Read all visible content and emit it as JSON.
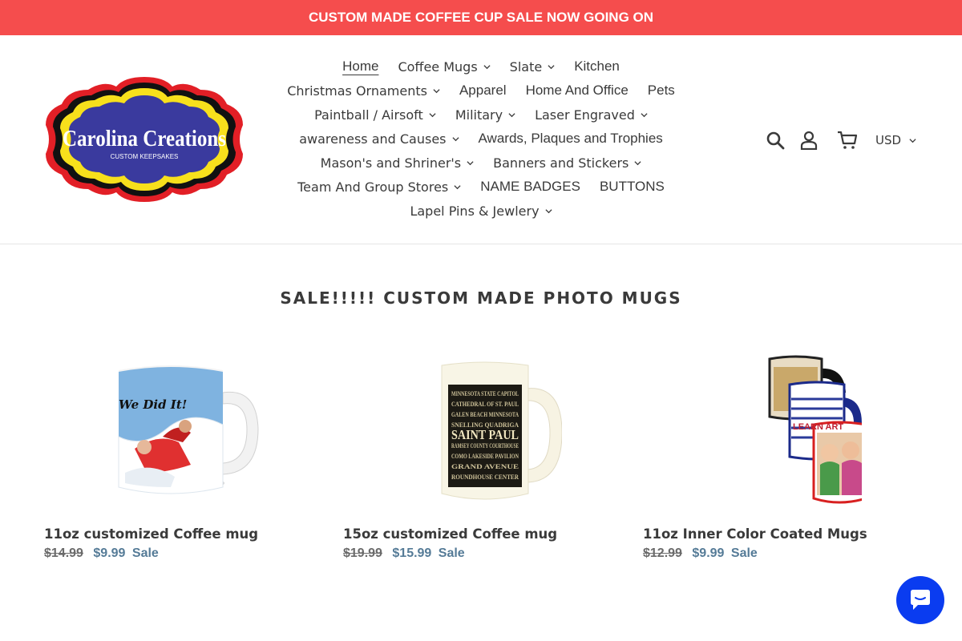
{
  "announcement": "CUSTOM MADE COFFEE CUP SALE NOW GOING ON",
  "logo": {
    "name": "Carolina Creations",
    "tagline": "CUSTOM KEEPSAKES"
  },
  "nav": {
    "rows": [
      [
        {
          "label": "Home",
          "dropdown": false,
          "active": true
        },
        {
          "label": "Coffee Mugs",
          "dropdown": true
        },
        {
          "label": "Slate",
          "dropdown": true
        },
        {
          "label": "Kitchen",
          "dropdown": false
        }
      ],
      [
        {
          "label": "Christmas Ornaments",
          "dropdown": true
        },
        {
          "label": "Apparel",
          "dropdown": false
        },
        {
          "label": "Home And Office",
          "dropdown": false
        },
        {
          "label": "Pets",
          "dropdown": false
        }
      ],
      [
        {
          "label": "Paintball / Airsoft",
          "dropdown": true
        },
        {
          "label": "Military",
          "dropdown": true
        },
        {
          "label": "Laser Engraved",
          "dropdown": true
        }
      ],
      [
        {
          "label": "awareness and Causes",
          "dropdown": true
        },
        {
          "label": "Awards, Plaques and Trophies",
          "dropdown": false
        }
      ],
      [
        {
          "label": "Mason's and Shriner's",
          "dropdown": true
        },
        {
          "label": "Banners and Stickers",
          "dropdown": true
        }
      ],
      [
        {
          "label": "Team And Group Stores",
          "dropdown": true
        },
        {
          "label": "NAME BADGES",
          "dropdown": false
        },
        {
          "label": "BUTTONS",
          "dropdown": false
        }
      ],
      [
        {
          "label": "Lapel Pins & Jewlery",
          "dropdown": true
        }
      ]
    ]
  },
  "header_tools": {
    "icons": [
      "search-icon",
      "account-icon",
      "cart-icon"
    ],
    "currency": "USD"
  },
  "collection": {
    "title": "SALE!!!!! CUSTOM MADE PHOTO MUGS",
    "products": [
      {
        "name": "11oz customized Coffee mug",
        "regular_price": "$14.99",
        "sale_price": "$9.99",
        "sale_label": "Sale",
        "image_text": "We Did It!"
      },
      {
        "name": "15oz customized Coffee mug",
        "regular_price": "$19.99",
        "sale_price": "$15.99",
        "sale_label": "Sale",
        "image_lines": [
          "MINNESOTA STATE CAPITOL",
          "CATHEDRAL OF ST. PAUL",
          "GALEN BEACH   MINNESOTA",
          "SNELLING  QUADRIGA",
          "SAINT PAUL",
          "RAMSEY COUNTY COURTHOUSE",
          "COMO LAKESIDE PAVILION",
          "GRAND AVENUE",
          "ROUNDHOUSE   CENTER"
        ]
      },
      {
        "name": "11oz Inner Color Coated Mugs",
        "regular_price": "$12.99",
        "sale_price": "$9.99",
        "sale_label": "Sale",
        "image_text": "LEARN ART"
      }
    ]
  },
  "colors": {
    "announcement_bg": "#f54d4d",
    "sale_price": "#557b97",
    "chat_button": "#0a3cf0"
  }
}
